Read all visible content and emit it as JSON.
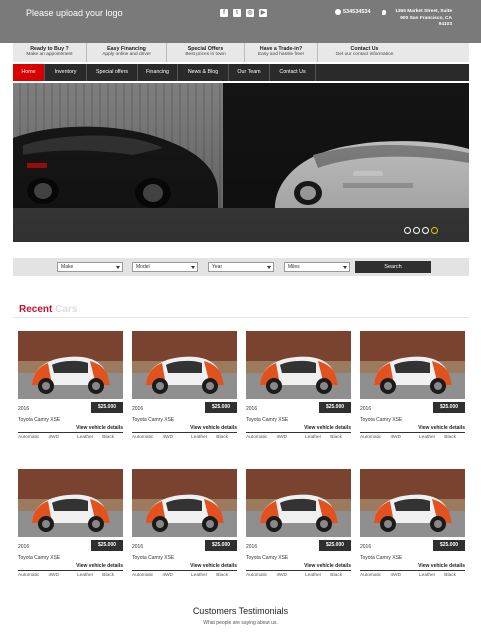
{
  "header": {
    "logo_text": "Please upload your logo",
    "social_icons": [
      "facebook-icon",
      "twitter-icon",
      "instagram-icon",
      "youtube-icon"
    ],
    "phone": "534534534",
    "address_line1": "1355 Market Street, Suite",
    "address_line2": "900 San Francisco, CA",
    "address_line3": "94103"
  },
  "info_strip": [
    {
      "title": "Ready to Buy ?",
      "sub": "Make an appointment"
    },
    {
      "title": "Easy Financing",
      "sub": "Apply online and drive!"
    },
    {
      "title": "Special Offers",
      "sub": "Best prices in town"
    },
    {
      "title": "Have a Trade-in?",
      "sub": "Easy and hassle free!"
    },
    {
      "title": "Contact Us",
      "sub": "Get our contact information"
    }
  ],
  "nav": [
    "Home",
    "Inventory",
    "Special offers",
    "Financing",
    "News & Blog",
    "Our Team",
    "Contact Us"
  ],
  "hero": {
    "active_dot": 4
  },
  "search": {
    "make": "Make",
    "model": "Model",
    "year": "Year",
    "miles": "Miles",
    "button": "Search"
  },
  "recent": {
    "title_a": "Recent",
    "title_b": "Cars"
  },
  "cars": [
    {
      "year": "2016",
      "price": "$25.000",
      "model": "Toyota Camry XSE",
      "link": "View vehicle details",
      "trans": "Automatic",
      "drive": "4WD",
      "interior": "Leather",
      "color": "Black"
    },
    {
      "year": "2016",
      "price": "$25.000",
      "model": "Toyota Camry XSE",
      "link": "View vehicle details",
      "trans": "Automatic",
      "drive": "4WD",
      "interior": "Leather",
      "color": "Black"
    },
    {
      "year": "2016",
      "price": "$25.000",
      "model": "Toyota Camry XSE",
      "link": "View vehicle details",
      "trans": "Automatic",
      "drive": "4WD",
      "interior": "Leather",
      "color": "Black"
    },
    {
      "year": "2016",
      "price": "$25.000",
      "model": "Toyota Camry XSE",
      "link": "View vehicle details",
      "trans": "Automatic",
      "drive": "4WD",
      "interior": "Leather",
      "color": "Black"
    },
    {
      "year": "2016",
      "price": "$25.000",
      "model": "Toyota Camry XSE",
      "link": "View vehicle details",
      "trans": "Automatic",
      "drive": "4WD",
      "interior": "Leather",
      "color": "Black"
    },
    {
      "year": "2016",
      "price": "$25.000",
      "model": "Toyota Camry XSE",
      "link": "View vehicle details",
      "trans": "Automatic",
      "drive": "4WD",
      "interior": "Leather",
      "color": "Black"
    },
    {
      "year": "2016",
      "price": "$25.000",
      "model": "Toyota Camry XSE",
      "link": "View vehicle details",
      "trans": "Automatic",
      "drive": "4WD",
      "interior": "Leather",
      "color": "Black"
    },
    {
      "year": "2016",
      "price": "$25.000",
      "model": "Toyota Camry XSE",
      "link": "View vehicle details",
      "trans": "Automatic",
      "drive": "4WD",
      "interior": "Leather",
      "color": "Black"
    }
  ],
  "testimonials": {
    "title": "Customers Testimonials",
    "subtitle": "What people are saying about us."
  },
  "colors": {
    "topbar": "#7a7a7a",
    "nav": "#2a2a2a",
    "accent": "#d80000",
    "recent_red": "#c8102e",
    "price_bg": "#2f2f2f"
  }
}
